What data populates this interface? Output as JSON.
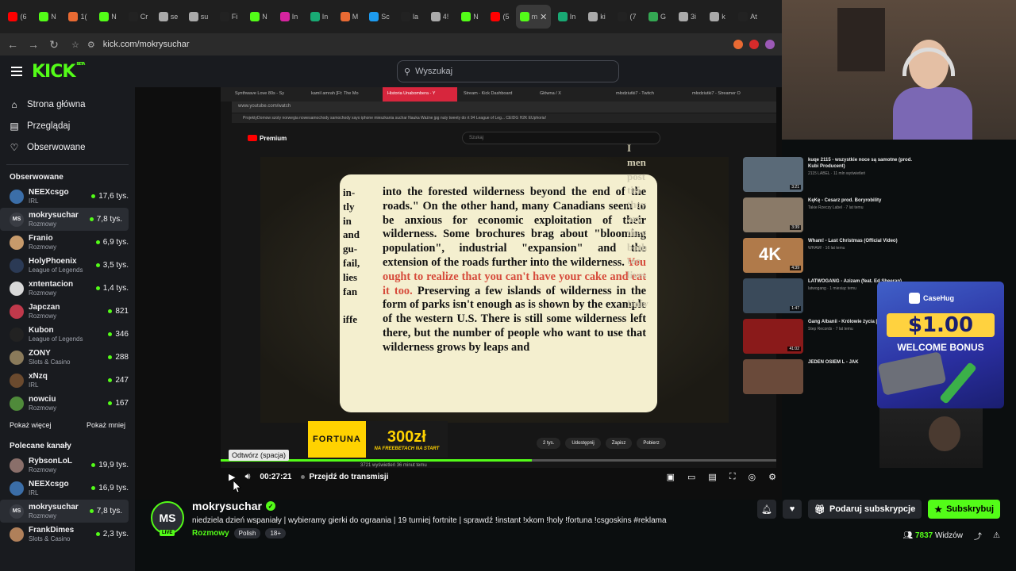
{
  "browser": {
    "tabs": [
      {
        "label": "(6",
        "color": "#ff0000"
      },
      {
        "label": "N",
        "color": "#53fc18"
      },
      {
        "label": "1(",
        "color": "#e86a33"
      },
      {
        "label": "N",
        "color": "#53fc18"
      },
      {
        "label": "Cr",
        "color": "#222222"
      },
      {
        "label": "se",
        "color": "#aaaaaa"
      },
      {
        "label": "su",
        "color": "#aaaaaa"
      },
      {
        "label": "Fi",
        "color": "#222222"
      },
      {
        "label": "N",
        "color": "#53fc18"
      },
      {
        "label": "In",
        "color": "#d6249f"
      },
      {
        "label": "In",
        "color": "#19a974"
      },
      {
        "label": "M",
        "color": "#e86a33"
      },
      {
        "label": "Sc",
        "color": "#1d9bf0"
      },
      {
        "label": "la",
        "color": "#222222"
      },
      {
        "label": "4!",
        "color": "#aaaaaa"
      },
      {
        "label": "N",
        "color": "#53fc18"
      },
      {
        "label": "(5",
        "color": "#ff0000"
      },
      {
        "label": "m",
        "color": "#53fc18",
        "active": true
      },
      {
        "label": "In",
        "color": "#19a974"
      },
      {
        "label": "ki",
        "color": "#aaaaaa"
      },
      {
        "label": "(7",
        "color": "#222222"
      },
      {
        "label": "G",
        "color": "#34a853"
      },
      {
        "label": "3i",
        "color": "#aaaaaa"
      },
      {
        "label": "k",
        "color": "#aaaaaa"
      },
      {
        "label": "At",
        "color": "#222222"
      }
    ],
    "url": "kick.com/mokrysuchar",
    "extension_colors": [
      "#e86a33",
      "#d62b2b",
      "#9b59b6"
    ]
  },
  "header": {
    "logo": "KICK",
    "logo_beta": "BETA",
    "search_placeholder": "Wyszukaj"
  },
  "sidebar": {
    "nav": [
      {
        "icon": "home-icon",
        "glyph": "⌂",
        "label": "Strona główna"
      },
      {
        "icon": "browse-icon",
        "glyph": "▤",
        "label": "Przeglądaj"
      },
      {
        "icon": "heart-icon",
        "glyph": "♡",
        "label": "Obserwowane"
      }
    ],
    "followed_title": "Obserwowane",
    "followed": [
      {
        "name": "NEEXcsgo",
        "category": "IRL",
        "viewers": "17,6 tys.",
        "color": "#3b6ea8",
        "initials": ""
      },
      {
        "name": "mokrysuchar",
        "category": "Rozmowy",
        "viewers": "7,8 tys.",
        "color": "#3a3d44",
        "initials": "MS",
        "active": true
      },
      {
        "name": "Franio",
        "category": "Rozmowy",
        "viewers": "6,9 tys.",
        "color": "#c79a6b",
        "initials": ""
      },
      {
        "name": "HolyPhoenix",
        "category": "League of Legends",
        "viewers": "3,5 tys.",
        "color": "#2b3a55",
        "initials": ""
      },
      {
        "name": "xntentacion",
        "category": "Rozmowy",
        "viewers": "1,4 tys.",
        "color": "#d9d9d9",
        "initials": ""
      },
      {
        "name": "Japczan",
        "category": "Rozmowy",
        "viewers": "821",
        "color": "#c0394b",
        "initials": ""
      },
      {
        "name": "Kubon",
        "category": "League of Legends",
        "viewers": "346",
        "color": "#222222",
        "initials": ""
      },
      {
        "name": "ZONY",
        "category": "Slots & Casino",
        "viewers": "288",
        "color": "#8a7a5a",
        "initials": ""
      },
      {
        "name": "xNzq",
        "category": "IRL",
        "viewers": "247",
        "color": "#6b4a2e",
        "initials": ""
      },
      {
        "name": "nowciu",
        "category": "Rozmowy",
        "viewers": "167",
        "color": "#4f8a3a",
        "initials": ""
      }
    ],
    "show_more": "Pokaż więcej",
    "show_less": "Pokaż mniej",
    "recommended_title": "Polecane kanały",
    "recommended": [
      {
        "name": "RybsonLoL",
        "category": "Rozmowy",
        "viewers": "19,9 tys.",
        "color": "#8a6f6a",
        "initials": ""
      },
      {
        "name": "NEEXcsgo",
        "category": "IRL",
        "viewers": "16,9 tys.",
        "color": "#3b6ea8",
        "initials": ""
      },
      {
        "name": "mokrysuchar",
        "category": "Rozmowy",
        "viewers": "7,8 tys.",
        "color": "#3a3d44",
        "initials": "MS",
        "active": true
      },
      {
        "name": "FrankDimes",
        "category": "Slots & Casino",
        "viewers": "2,3 tys.",
        "color": "#b0805a",
        "initials": ""
      }
    ]
  },
  "stream_video": {
    "yt_tabs": [
      "Synthwave Love 80s - Sy",
      "kamil amrah [Ft: The Mo",
      "Historia Unabombera - Y",
      "Stream - Kick Dashboard",
      "Główna / X",
      "młodziutki7 - Twitch",
      "młodziutki7 - Streamer O"
    ],
    "yt_url": "www.youtube.com/watch",
    "yt_bookmarks": "ProjektyDomow   szoty   norwegia   nowesamochody   samochody xayo   iphone   mieszkania suchar   Nauka   Ważne jpg   nuty   tweety do rt   94 League of Leg...   CEIDG   H2K EUphoria!",
    "yt_logo": "Premium",
    "yt_search": "Szukaj",
    "page_left_col": [
      "in-",
      "tly",
      "in",
      "and",
      "gu-",
      "fail,",
      "lies",
      "fan",
      "",
      "iffe"
    ],
    "page_text_before": "into the forested wilderness beyond the end of the roads.\" On the other hand, many Canadians seem to be anxious for economic exploitation of their wilderness. Some brochures brag about \"blooming population\", industrial \"expansion\" and the extension of the roads further into the wilderness. ",
    "page_text_highlight": "You ought to realize that you can't have your cake and eat it too.",
    "page_text_after": " Preserving a few islands of wilderness in the form of parks isn't enough as is shown by the example of the western U.S. There is still some wilderness left there, but the number of people who want to use that wilderness grows by leaps and",
    "page_right_col": [
      "I",
      "men",
      "post",
      "tisi",
      "they",
      "ary",
      "they",
      "both",
      "too",
      "lives",
      "",
      "Univ"
    ],
    "recommendations": [
      {
        "title": "kuqe 2115 - wszystkie noce są samotne (prod. Kubi Producent)",
        "meta": "2115 LABEL · 11 mln wyświetleń",
        "duration": "3:21",
        "color": "#5a6a78"
      },
      {
        "title": "KęKę - Cesarz prod. Boryrobility",
        "meta": "Takie Rzeczy Label · 7 lat temu",
        "duration": "3:39",
        "color": "#8a7a68"
      },
      {
        "title": "Wham! - Last Christmas (Official Video)",
        "meta": "WHAM! · 16 lat temu",
        "duration": "4:39",
        "color": "#b07a4a",
        "thumb_text": "4K"
      },
      {
        "title": "LATWOGANG - Azizam (feat. Ed Sheeran)",
        "meta": "latwogang · 1 miesiąc temu",
        "duration": "1:47",
        "color": "#3a4a5a"
      },
      {
        "title": "Gang Albanii - Królowie życia [cały album]",
        "meta": "Step Records · 7 lat temu",
        "duration": "41:02",
        "color": "#8a1a1a"
      },
      {
        "title": "JEDEN OSIEM L - JAK",
        "meta": "",
        "duration": "",
        "color": "#6a4a3a"
      }
    ],
    "ad": {
      "brand": "FORTUNA",
      "amount": "300zł",
      "sub": "NA FREEBETACH NA START"
    },
    "yt_actions": [
      "2 tys.",
      "Udostępnij",
      "Zapisz",
      "Pobierz"
    ],
    "yt_views": "3721 wyświetleń  36 minut temu",
    "casino": {
      "brand": "CaseHug",
      "amount": "$1.00",
      "bonus": "WELCOME BONUS"
    },
    "progress": 0.56,
    "tooltip": "Odtwórz (spacja)",
    "time": "00:27:21",
    "live_jump": "Przejdź do transmisji"
  },
  "stream_info": {
    "avatar_initials": "MS",
    "live_label": "LIVE",
    "streamer": "mokrysuchar",
    "title": "niedziela dzień wspaniały | wybieramy gierki do ograania | 19 turniej fortnite | sprawdź !instant !xkom !holy !fortuna !csgoskins #reklama",
    "category": "Rozmowy",
    "tags": [
      "Polish",
      "18+"
    ],
    "gift_label": "Podaruj subskrypcje",
    "subscribe_label": "Subskrybuj",
    "viewer_count": "7837",
    "viewer_label": "Widzów"
  }
}
